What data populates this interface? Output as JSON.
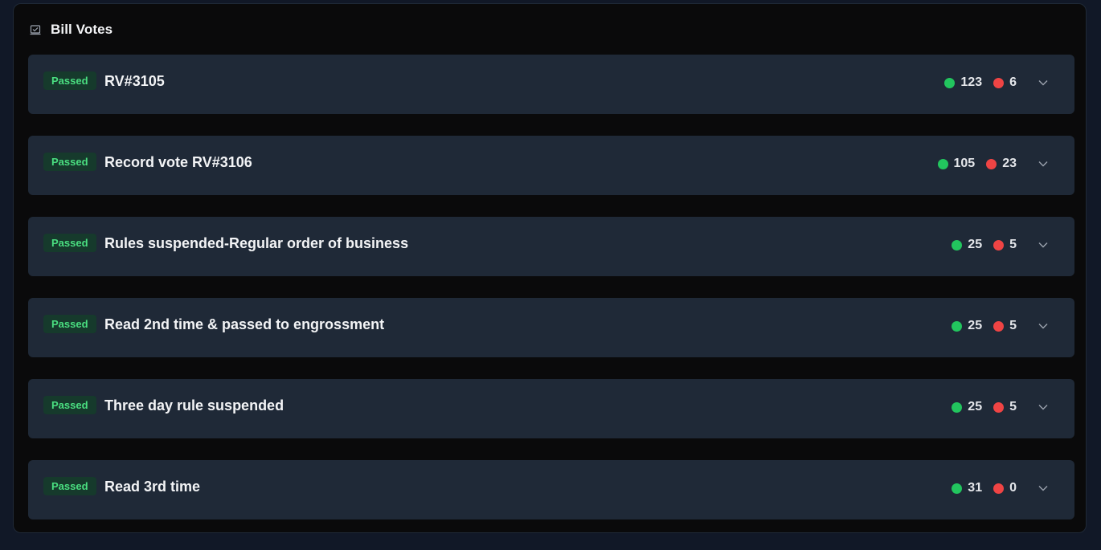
{
  "header": {
    "title": "Bill Votes",
    "icon": "ballot-box-icon"
  },
  "colors": {
    "yes": "#22c55e",
    "no": "#ef4444",
    "passed_badge_text": "#4ade80",
    "passed_badge_bg": "#163a2c"
  },
  "votes": [
    {
      "status": "Passed",
      "title": "RV#3105",
      "yes": "123",
      "no": "6"
    },
    {
      "status": "Passed",
      "title": "Record vote RV#3106",
      "yes": "105",
      "no": "23"
    },
    {
      "status": "Passed",
      "title": "Rules suspended-Regular order of business",
      "yes": "25",
      "no": "5"
    },
    {
      "status": "Passed",
      "title": "Read 2nd time & passed to engrossment",
      "yes": "25",
      "no": "5"
    },
    {
      "status": "Passed",
      "title": "Three day rule suspended",
      "yes": "25",
      "no": "5"
    },
    {
      "status": "Passed",
      "title": "Read 3rd time",
      "yes": "31",
      "no": "0"
    }
  ]
}
